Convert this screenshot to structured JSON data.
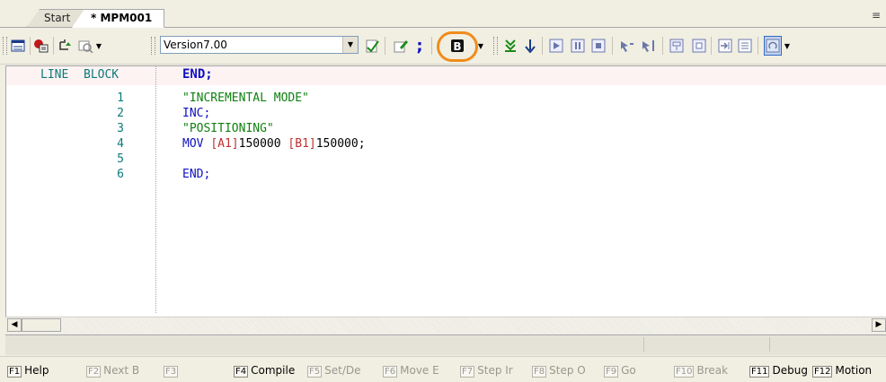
{
  "tabs": [
    {
      "label": "Start"
    },
    {
      "label": "* MPM001"
    }
  ],
  "pin_icon": "pin-icon",
  "toolbar": {
    "version": "Version7.00",
    "icons": [
      "window-icon",
      "debug-breakpoint-icon",
      "undo-icon",
      "find-icon",
      "compile-icon",
      "edit-icon",
      "semicolon-icon",
      "block-icon",
      "step-icon",
      "down-arrow-icon",
      "play-icon",
      "pause-icon",
      "stop-icon",
      "cursor-icon",
      "cursor-end-icon",
      "watch-icon",
      "monitor-icon",
      "jump-icon",
      "list-icon",
      "refresh-icon"
    ],
    "highlight_color": "#f08c1a"
  },
  "editor": {
    "header": {
      "line": "LINE",
      "block": "BLOCK",
      "statement": "END;"
    },
    "lines": [
      {
        "no": "1",
        "text": "\"INCREMENTAL MODE\""
      },
      {
        "no": "2",
        "text": "INC;"
      },
      {
        "no": "3",
        "text": "\"POSITIONING\""
      },
      {
        "no": "4",
        "kw": "MOV ",
        "a": "[A1]",
        "av": "150000 ",
        "b": "[B1]",
        "bv": "150000;"
      },
      {
        "no": "5",
        "text": ""
      },
      {
        "no": "6",
        "text": "END;"
      }
    ]
  },
  "fkeys": [
    {
      "key": "F1",
      "label": "Help",
      "enabled": true
    },
    {
      "key": "F2",
      "label": "Next B ",
      "enabled": false
    },
    {
      "key": "F3",
      "label": "",
      "enabled": false
    },
    {
      "key": "F4",
      "label": "Compile",
      "enabled": true
    },
    {
      "key": "F5",
      "label": "Set/De",
      "enabled": false
    },
    {
      "key": "F6",
      "label": "Move E",
      "enabled": false
    },
    {
      "key": "F7",
      "label": "Step Ir",
      "enabled": false
    },
    {
      "key": "F8",
      "label": "Step O",
      "enabled": false
    },
    {
      "key": "F9",
      "label": "Go",
      "enabled": false
    },
    {
      "key": "F10",
      "label": "Break",
      "enabled": false
    },
    {
      "key": "F11",
      "label": "Debug",
      "enabled": true
    },
    {
      "key": "F12",
      "label": "Motion",
      "enabled": true
    }
  ]
}
